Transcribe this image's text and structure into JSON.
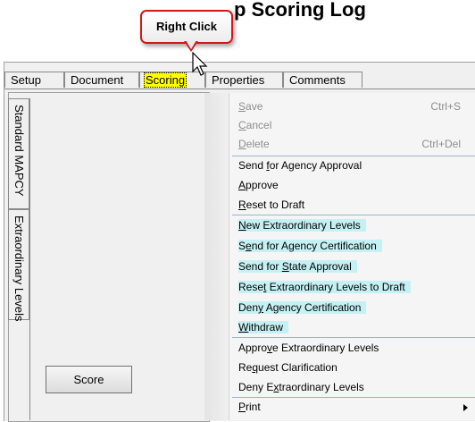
{
  "title": "p Scoring Log",
  "callout": "Right Click",
  "tabs": [
    "Setup",
    "Document",
    "Scoring",
    "Properties",
    "Comments"
  ],
  "side_tabs": [
    "Standard MAPCY",
    "Extraordinary Levels"
  ],
  "score_button": "Score",
  "menu": {
    "items": [
      {
        "label": "Save",
        "shortcut": "Ctrl+S",
        "disabled": true,
        "highlighted": false
      },
      {
        "label": "Cancel",
        "shortcut": "",
        "disabled": true,
        "highlighted": false
      },
      {
        "label": "Delete",
        "shortcut": "Ctrl+Del",
        "disabled": true,
        "highlighted": false
      },
      {
        "label": "Send for Agency Approval",
        "shortcut": "",
        "disabled": false,
        "highlighted": false
      },
      {
        "label": "Approve",
        "shortcut": "",
        "disabled": false,
        "highlighted": false
      },
      {
        "label": "Reset to Draft",
        "shortcut": "",
        "disabled": false,
        "highlighted": false
      },
      {
        "label": "New Extraordinary Levels",
        "shortcut": "",
        "disabled": false,
        "highlighted": true
      },
      {
        "label": "Send for Agency Certification",
        "shortcut": "",
        "disabled": false,
        "highlighted": true
      },
      {
        "label": "Send for State Approval",
        "shortcut": "",
        "disabled": false,
        "highlighted": true
      },
      {
        "label": "Reset Extraordinary Levels to Draft",
        "shortcut": "",
        "disabled": false,
        "highlighted": true
      },
      {
        "label": "Deny Agency Certification",
        "shortcut": "",
        "disabled": false,
        "highlighted": true
      },
      {
        "label": "Withdraw",
        "shortcut": "",
        "disabled": false,
        "highlighted": true
      },
      {
        "label": "Approve Extraordinary Levels",
        "shortcut": "",
        "disabled": false,
        "highlighted": false
      },
      {
        "label": "Request Clarification",
        "shortcut": "",
        "disabled": false,
        "highlighted": false
      },
      {
        "label": "Deny Extraordinary Levels",
        "shortcut": "",
        "disabled": false,
        "highlighted": false
      },
      {
        "label": "Print",
        "shortcut": "",
        "disabled": false,
        "highlighted": false
      }
    ]
  },
  "colors": {
    "highlight": "#c6f1f4",
    "tab_highlight": "#ffff00",
    "callout_border": "#d01818"
  }
}
